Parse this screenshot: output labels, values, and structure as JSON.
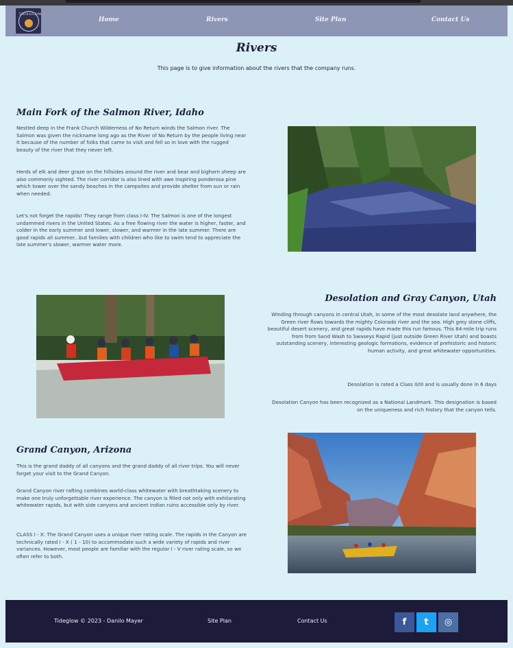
{
  "nav": {
    "logo_text": "TIDEGLOW",
    "items": [
      "Home",
      "Rivers",
      "Site Plan",
      "Contact Us"
    ]
  },
  "page": {
    "title": "Rivers",
    "intro": "This page is to give information about the rivers that the company runs."
  },
  "sections": [
    {
      "title": "Main Fork of the Salmon River, Idaho",
      "paragraphs": [
        "Nestled deep in the Frank Church Wilderness of No Return winds the Salmon river. The Salmon was given the nickname long ago as the River of No Return by the people living near it because of the number of folks that came to visit and fell so in love with the rugged beauty of the river that they never left.",
        "Herds of elk and deer graze on the hillsides around the river and bear and bighorn sheep are also commonly sighted. The river corridor is also lined with awe inspiring ponderosa pine which tower over the sandy beaches in the campsites and provide shelter from sun or rain when needed.",
        "Let's not forget the rapids! They range from class I-IV. The Salmon is one of the longest undammed rivers in the United States. As a free flowing river the water is higher, faster, and colder in the early summer and lower, slower, and warmer in the late summer. There are good rapids all summer...but families with children who like to swim tend to appreciate the late summer's slower, warmer water more."
      ]
    },
    {
      "title": "Desolation and Gray Canyon, Utah",
      "paragraphs": [
        "Winding through canyons in central Utah, in some of the most desolate land anywhere, the Green river flows towards the mighty Colorado river and the sea. High grey stone cliffs, beautiful desert scenery, and great rapids have made this run famous. This 84-mile trip runs from from Sand Wash to Swaseys Rapid (just outside Green River Utah) and boasts outstanding scenery, interesting geologic formations, evidence of prehistoric and historic human activity, and great whitewater opportunities.",
        "Desolation is rated a Class II/III and is usually done in 6 days",
        "Desolation Canyon has been recognized as a National Landmark. This designation is based on the uniqueness and rich history that the canyon tells."
      ]
    },
    {
      "title": "Grand Canyon, Arizona",
      "paragraphs": [
        "This is the grand daddy of all canyons and the grand daddy of all river trips. You will never forget your visit to the Grand Canyon.",
        "Grand Canyon river rafting combines world-class whitewater with breathtaking scenery to make one truly unforgettable river experience. The canyon is filled not only with exhilarating whitewater rapids, but with side canyons and ancient indian ruins accessible only by river.",
        "CLASS I - X: The Grand Canyon uses a unique river rating scale. The rapids in the Canyon are technically rated I - X ( 1 - 10) to accommodate such a wide variety of rapids and river variances. However, most people are familiar with the regular I - V river rating scale, so we often refer to both."
      ]
    }
  ],
  "footer": {
    "copyright": "Tideglow © 2023 - Danilo Mayer",
    "links": [
      "Site Plan",
      "Contact Us"
    ],
    "social": [
      {
        "icon": "facebook-icon",
        "glyph": "f",
        "color": "#3b5998"
      },
      {
        "icon": "twitter-icon",
        "glyph": "t",
        "color": "#1da1f2"
      },
      {
        "icon": "instagram-icon",
        "glyph": "◎",
        "color": "#4a6fa5"
      }
    ]
  },
  "colors": {
    "background": "#dcf0f8",
    "header": "#8d97b5",
    "footer": "#1c1c3a",
    "heading": "#1d1e3c"
  }
}
